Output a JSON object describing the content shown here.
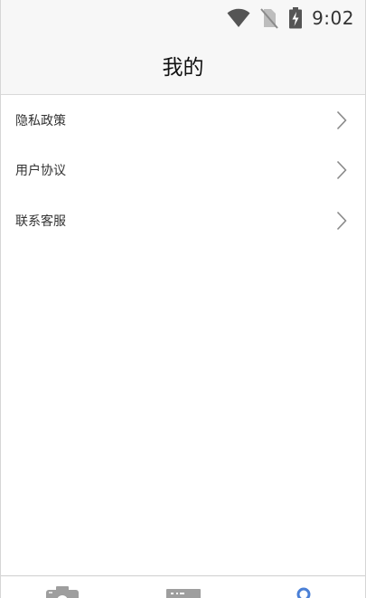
{
  "status_bar": {
    "time": "9:02",
    "icons": [
      "wifi-icon",
      "no-sim-icon",
      "battery-charging-icon"
    ]
  },
  "header": {
    "title": "我的"
  },
  "menu": {
    "items": [
      {
        "label": "隐私政策",
        "icon": "chevron-right-icon"
      },
      {
        "label": "用户协议",
        "icon": "chevron-right-icon"
      },
      {
        "label": "联系客服",
        "icon": "chevron-right-icon"
      }
    ]
  },
  "tab_bar": {
    "tabs": [
      {
        "icon": "camera-icon",
        "active": false
      },
      {
        "icon": "id-card-icon",
        "active": false
      },
      {
        "icon": "profile-icon",
        "active": true
      }
    ],
    "colors": {
      "inactive": "#9e9e9e",
      "active": "#4a7fd6"
    }
  }
}
